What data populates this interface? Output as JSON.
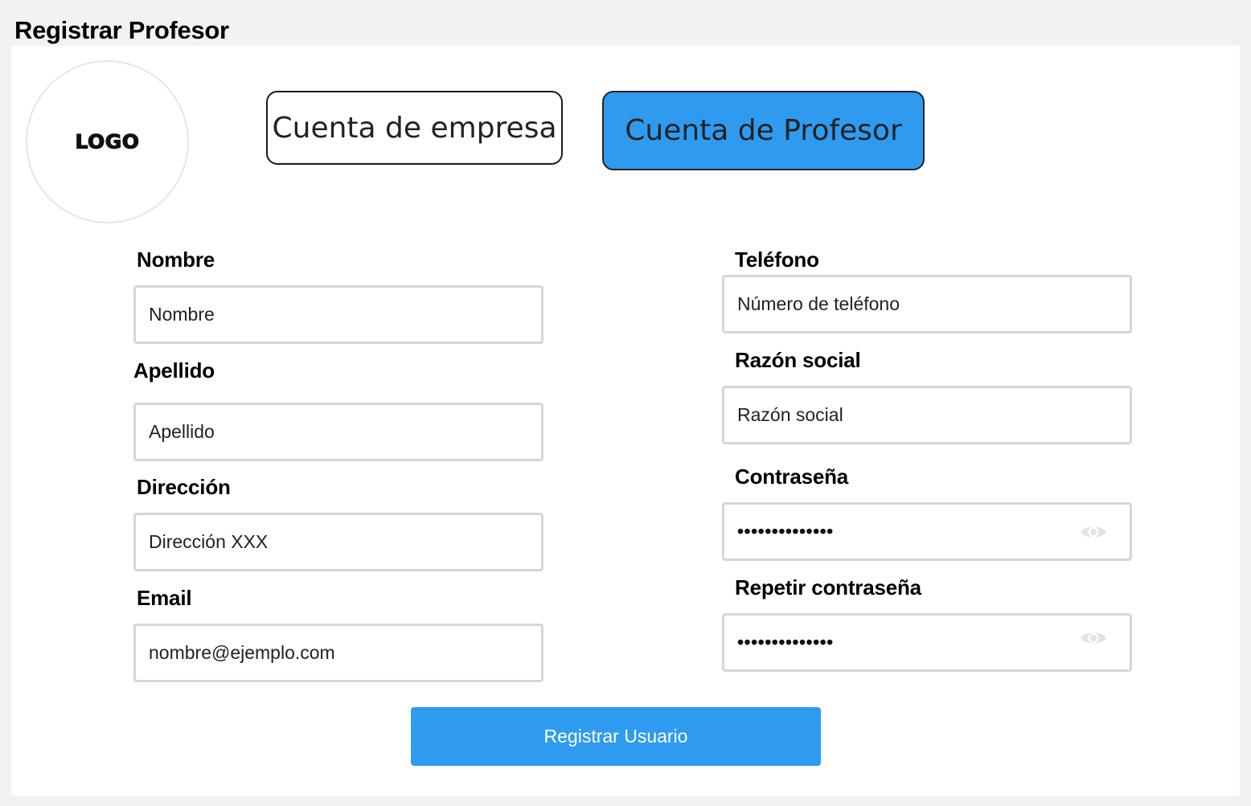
{
  "page": {
    "title": "Registrar Profesor"
  },
  "logo": {
    "text": "LOGO"
  },
  "account_types": {
    "company": "Cuenta de empresa",
    "teacher": "Cuenta de Profesor",
    "selected": "teacher"
  },
  "form": {
    "nombre": {
      "label": "Nombre",
      "value": "Nombre"
    },
    "apellido": {
      "label": "Apellido",
      "value": "Apellido"
    },
    "direccion": {
      "label": "Dirección",
      "value": "Dirección XXX"
    },
    "email": {
      "label": "Email",
      "value": "nombre@ejemplo.com"
    },
    "telefono": {
      "label": "Teléfono",
      "value": "Número de teléfono"
    },
    "razon_social": {
      "label": "Razón social",
      "value": "Razón social"
    },
    "contrasena": {
      "label": "Contraseña",
      "masked_value": "••••••••••••••"
    },
    "repetir_contrasena": {
      "label": "Repetir contraseña",
      "masked_value": "••••••••••••••"
    }
  },
  "submit": {
    "label": "Registrar Usuario"
  },
  "colors": {
    "accent": "#2e9bf0",
    "field_border": "#d6d6d6",
    "background": "#f2f2f2"
  }
}
